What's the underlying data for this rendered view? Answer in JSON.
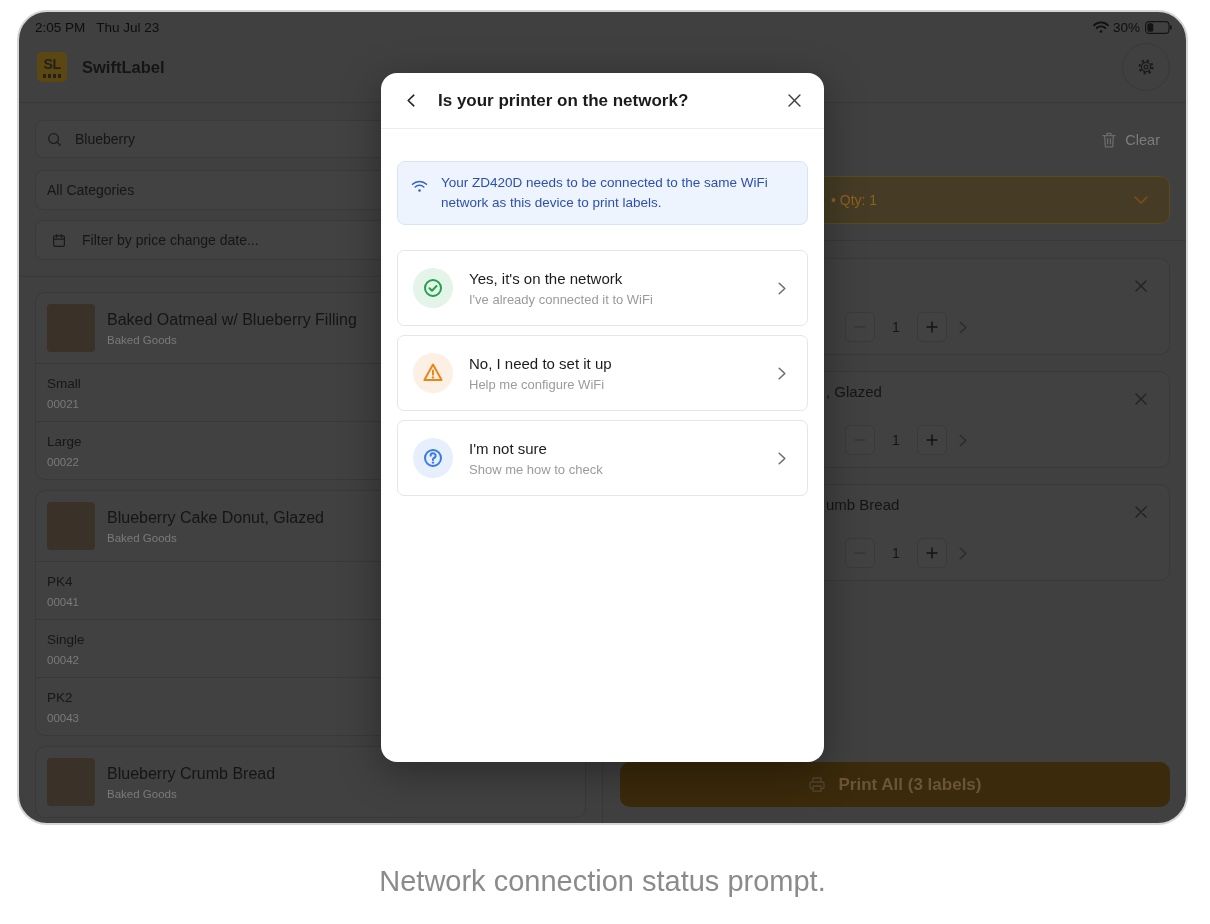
{
  "status_bar": {
    "time": "2:05 PM",
    "date": "Thu Jul 23",
    "battery": "30%"
  },
  "header": {
    "logo": "SL",
    "app_name": "SwiftLabel"
  },
  "filters": {
    "search": {
      "value": "Blueberry"
    },
    "category": {
      "value": "All Categories"
    },
    "date_filter": {
      "label": "Filter by price change date..."
    }
  },
  "products": [
    {
      "name": "Baked Oatmeal w/ Blueberry Filling",
      "category": "Baked Goods",
      "variants": [
        {
          "name": "Small",
          "code": "00021"
        },
        {
          "name": "Large",
          "code": "00022"
        }
      ]
    },
    {
      "name": "Blueberry Cake Donut, Glazed",
      "category": "Baked Goods",
      "variants": [
        {
          "name": "PK4",
          "code": "00041"
        },
        {
          "name": "Single",
          "code": "00042"
        },
        {
          "name": "PK2",
          "code": "00043"
        }
      ]
    },
    {
      "name": "Blueberry Crumb Bread",
      "category": "Baked Goods"
    }
  ],
  "cart": {
    "clear_label": "Clear",
    "summary": {
      "text": "• Qty: 1",
      "expanded": false
    },
    "items": [
      {
        "quantity": "1",
        "decrease_disabled": true
      },
      {
        "title": ", Glazed",
        "quantity": "1",
        "decrease_disabled": true
      },
      {
        "title": "umb Bread",
        "quantity": "1",
        "decrease_disabled": true
      }
    ],
    "print_button": "Print All (3 labels)"
  },
  "dialog": {
    "title": "Is your printer on the network?",
    "notice": "Your ZD420D needs to be connected to the same WiFi network as this device to print labels.",
    "options": [
      {
        "kind": "check",
        "color": "#22a04b",
        "title": "Yes, it's on the network",
        "subtitle": "I've already connected it to WiFi"
      },
      {
        "kind": "warning",
        "color": "#e8861a",
        "title": "No, I need to set it up",
        "subtitle": "Help me configure WiFi"
      },
      {
        "kind": "question",
        "color": "#3a7be6",
        "title": "I'm not sure",
        "subtitle": "Show me how to check"
      }
    ]
  },
  "caption": "Network connection status prompt."
}
